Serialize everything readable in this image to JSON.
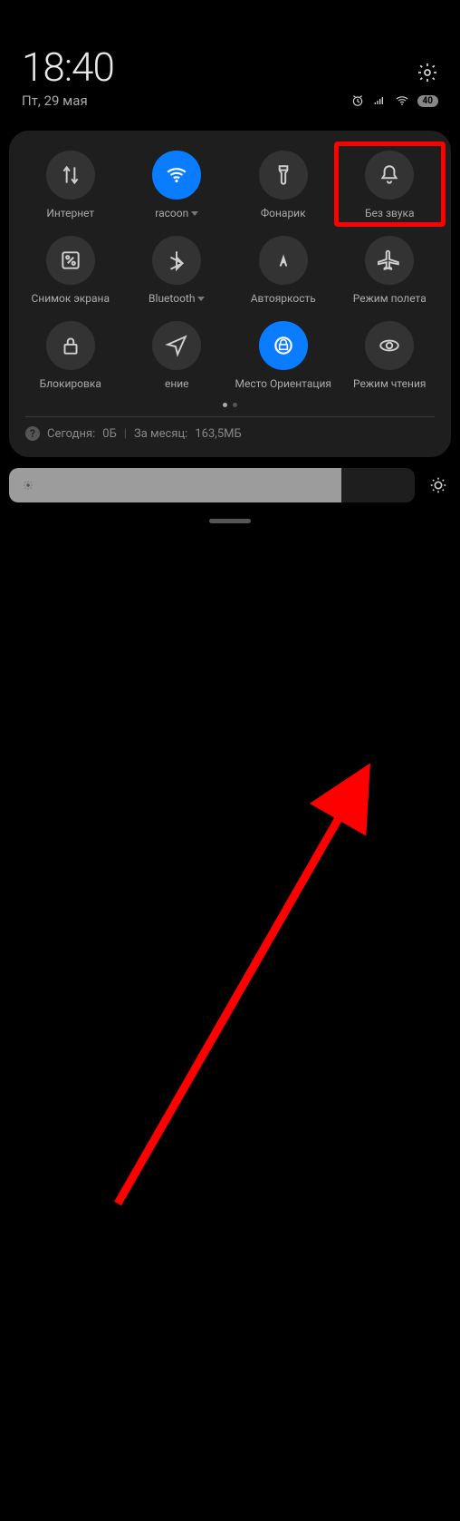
{
  "header": {
    "time": "18:40",
    "date": "Пт, 29 мая",
    "battery": "40"
  },
  "tiles": [
    {
      "id": "internet",
      "label": "Интернет",
      "active": false,
      "expandable": false
    },
    {
      "id": "wifi",
      "label": "racoon",
      "active": true,
      "expandable": true
    },
    {
      "id": "flashlight",
      "label": "Фонарик",
      "active": false,
      "expandable": false
    },
    {
      "id": "silent",
      "label": "Без звука",
      "active": false,
      "expandable": false
    },
    {
      "id": "screenshot",
      "label": "Снимок экрана",
      "active": false,
      "expandable": false
    },
    {
      "id": "bluetooth",
      "label": "Bluetooth",
      "active": false,
      "expandable": true
    },
    {
      "id": "autobrightness",
      "label": "Автояркость",
      "active": false,
      "expandable": false
    },
    {
      "id": "airplane",
      "label": "Режим полета",
      "active": false,
      "expandable": false
    },
    {
      "id": "lock",
      "label": "Блокировка",
      "active": false,
      "expandable": false
    },
    {
      "id": "location",
      "label": "ение",
      "active": false,
      "expandable": false
    },
    {
      "id": "orientation",
      "label": "Место   Ориентация",
      "active": true,
      "expandable": false
    },
    {
      "id": "reading",
      "label": "Режим чтения",
      "active": false,
      "expandable": false
    }
  ],
  "usage": {
    "today_label": "Сегодня:",
    "today_value": "0Б",
    "month_label": "За месяц:",
    "month_value": "163,5МБ"
  },
  "highlight": {
    "tile_index": 3
  },
  "brightness": {
    "percent": 82
  }
}
